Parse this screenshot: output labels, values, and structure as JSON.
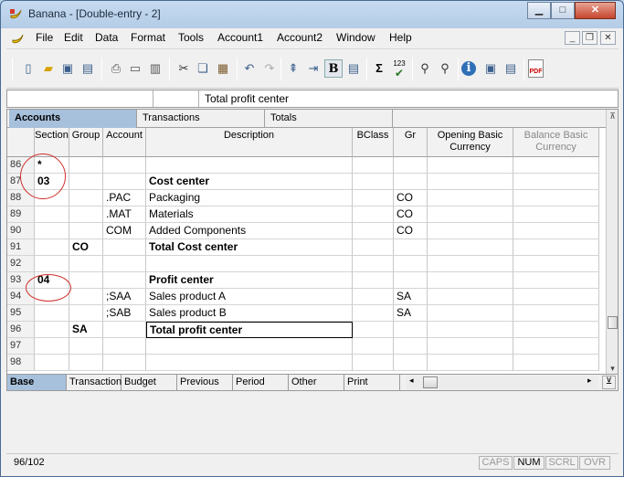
{
  "window": {
    "title": "Banana - [Double-entry - 2]"
  },
  "menu": [
    "File",
    "Edit",
    "Data",
    "Format",
    "Tools",
    "Account1",
    "Account2",
    "Window",
    "Help"
  ],
  "toolbar_icons": [
    "new-icon",
    "open-icon",
    "save-icon",
    "properties-icon",
    "print-icon",
    "print-preview-icon",
    "book-icon",
    "cut-icon",
    "copy-icon",
    "paste-icon",
    "undo-icon",
    "redo-icon",
    "insert-row-icon",
    "insert-col-icon",
    "bold-icon",
    "align-icon",
    "sum-icon",
    "spellcheck-icon",
    "find-icon",
    "replace-icon",
    "info-icon",
    "window-icon",
    "export-icon",
    "pdf-icon"
  ],
  "toolbar": {
    "bold_label": "B",
    "sum_label": "Σ",
    "spell_label": "123",
    "pdf_label": "PDF"
  },
  "formula_bar": {
    "value": "Total profit center"
  },
  "tables": [
    "Accounts",
    "Transactions",
    "Totals"
  ],
  "columns": [
    "Section",
    "Group",
    "Account",
    "Description",
    "BClass",
    "Gr",
    "Opening Basic Currency",
    "Balance Basic Currency"
  ],
  "rows": [
    {
      "n": "86",
      "section": "*",
      "group": "",
      "account": "",
      "description": "",
      "gr": "",
      "bold": false
    },
    {
      "n": "87",
      "section": "03",
      "group": "",
      "account": "",
      "description": "Cost center",
      "gr": "",
      "bold": true
    },
    {
      "n": "88",
      "section": "",
      "group": "",
      "account": ".PAC",
      "description": "Packaging",
      "gr": "CO",
      "bold": false
    },
    {
      "n": "89",
      "section": "",
      "group": "",
      "account": ".MAT",
      "description": "Materials",
      "gr": "CO",
      "bold": false
    },
    {
      "n": "90",
      "section": "",
      "group": "",
      "account": "COM",
      "description": "Added Components",
      "gr": "CO",
      "bold": false
    },
    {
      "n": "91",
      "section": "",
      "group": "CO",
      "account": "",
      "description": "Total Cost center",
      "gr": "",
      "bold": true
    },
    {
      "n": "92",
      "section": "",
      "group": "",
      "account": "",
      "description": "",
      "gr": "",
      "bold": false
    },
    {
      "n": "93",
      "section": "04",
      "group": "",
      "account": "",
      "description": "Profit center",
      "gr": "",
      "bold": true
    },
    {
      "n": "94",
      "section": "",
      "group": "",
      "account": ";SAA",
      "description": "Sales product A",
      "gr": "SA",
      "bold": false
    },
    {
      "n": "95",
      "section": "",
      "group": "",
      "account": ";SAB",
      "description": "Sales product B",
      "gr": "SA",
      "bold": false
    },
    {
      "n": "96",
      "section": "",
      "group": "SA",
      "account": "",
      "description": "Total profit center",
      "gr": "",
      "bold": true
    },
    {
      "n": "97",
      "section": "",
      "group": "",
      "account": "",
      "description": "",
      "gr": "",
      "bold": false
    },
    {
      "n": "98",
      "section": "",
      "group": "",
      "account": "",
      "description": "",
      "gr": "",
      "bold": false
    }
  ],
  "views": [
    "Base",
    "Transaction",
    "Budget",
    "Previous",
    "Period",
    "Other",
    "Print"
  ],
  "status": {
    "position": "96/102",
    "indicators": [
      "CAPS",
      "NUM",
      "SCRL",
      "OVR"
    ]
  },
  "colors": {
    "selected_tab": "#a7c0dc",
    "annotation_circle": "#d0302c"
  }
}
